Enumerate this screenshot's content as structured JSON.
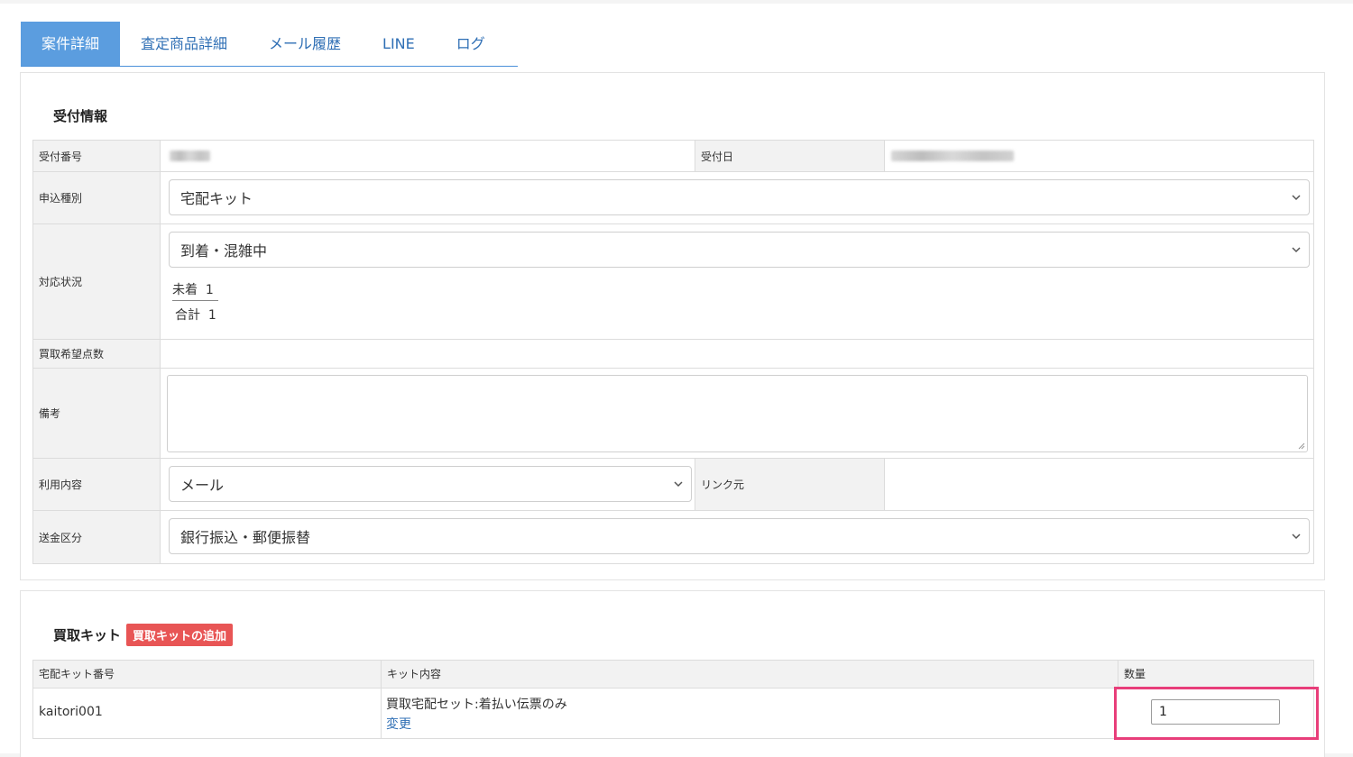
{
  "tabs": [
    "案件詳細",
    "査定商品詳細",
    "メール履歴",
    "LINE",
    "ログ"
  ],
  "reception": {
    "title": "受付情報",
    "labels": {
      "number": "受付番号",
      "date": "受付日",
      "type": "申込種別",
      "status": "対応状況",
      "desired_count": "買取希望点数",
      "notes": "備考",
      "usage": "利用内容",
      "link_source": "リンク元",
      "remit": "送金区分"
    },
    "type_value": "宅配キット",
    "status_value": "到着・混雑中",
    "status_pending": "未着",
    "status_pending_count": "1",
    "status_total": "合計",
    "status_total_count": "1",
    "usage_value": "メール",
    "remit_value": "銀行振込・郵便振替"
  },
  "kit": {
    "title": "買取キット",
    "add_label": "買取キットの追加",
    "headers": [
      "宅配キット番号",
      "キット内容",
      "数量"
    ],
    "rows": [
      {
        "number": "kaitori001",
        "content": "買取宅配セット:着払い伝票のみ",
        "change": "変更",
        "qty": "1"
      }
    ]
  },
  "colors": {
    "accent": "#5b9ddf",
    "link": "#2f6fb5",
    "badge": "#e85555",
    "highlight": "#e83e7a"
  }
}
